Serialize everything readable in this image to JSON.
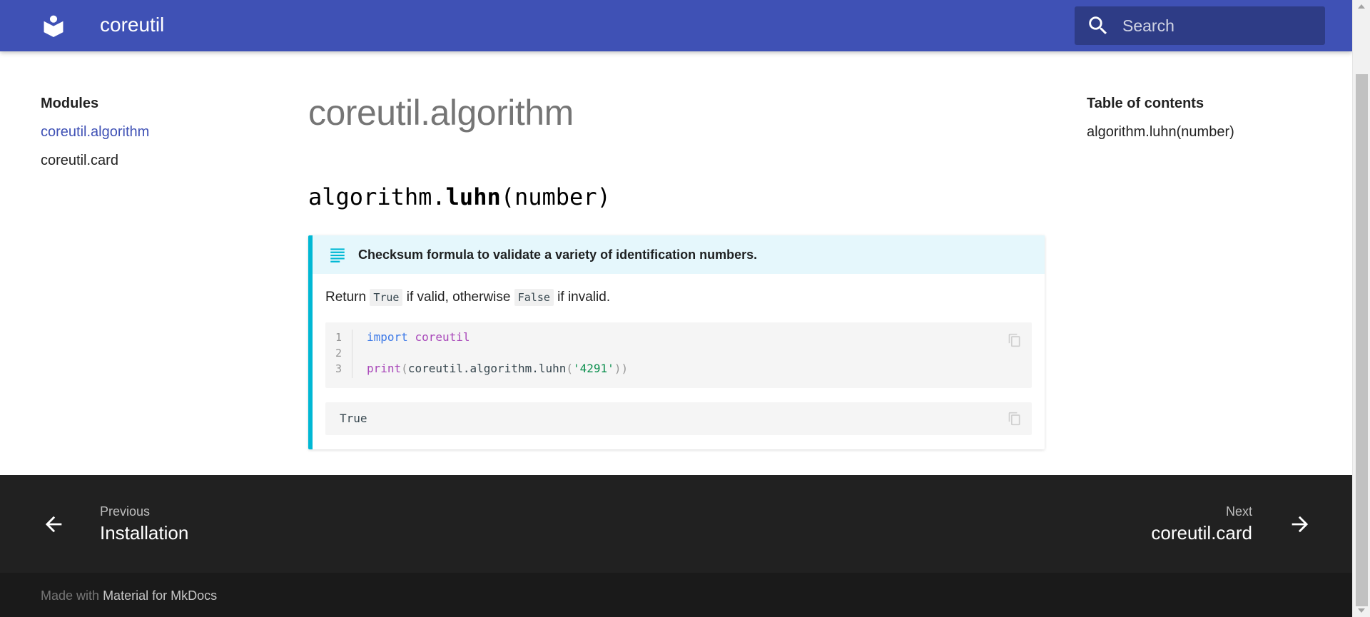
{
  "header": {
    "site_title": "coreutil",
    "search_placeholder": "Search",
    "colors": {
      "primary": "#3f51b5"
    }
  },
  "nav": {
    "heading": "Modules",
    "items": [
      {
        "label": "coreutil.algorithm",
        "active": true
      },
      {
        "label": "coreutil.card",
        "active": false
      }
    ]
  },
  "main": {
    "title": "coreutil.algorithm",
    "function": {
      "prefix": "algorithm.",
      "name": "luhn",
      "params": "(number)"
    },
    "admonition": {
      "icon": "text-lines-icon",
      "accent": "#00b8d4",
      "title": "Checksum formula to validate a variety of identification numbers.",
      "desc_return": "Return",
      "desc_true": "True",
      "desc_middle": "if valid, otherwise",
      "desc_false": "False",
      "desc_end": "if invalid."
    },
    "code": {
      "line_numbers": [
        "1",
        "2",
        "3"
      ],
      "line1_kw": "import",
      "line1_mod": "coreutil",
      "line3_fn": "print",
      "line3_open": "(",
      "line3_expr": "coreutil.algorithm.luhn",
      "line3_open2": "(",
      "line3_str": "'4291'",
      "line3_close": "))"
    },
    "output": "True"
  },
  "toc": {
    "heading": "Table of contents",
    "items": [
      "algorithm.luhn(number)"
    ]
  },
  "footer": {
    "prev_label": "Previous",
    "prev_page": "Installation",
    "next_label": "Next",
    "next_page": "coreutil.card",
    "made_with": "Made with",
    "made_with_link": "Material for MkDocs"
  }
}
